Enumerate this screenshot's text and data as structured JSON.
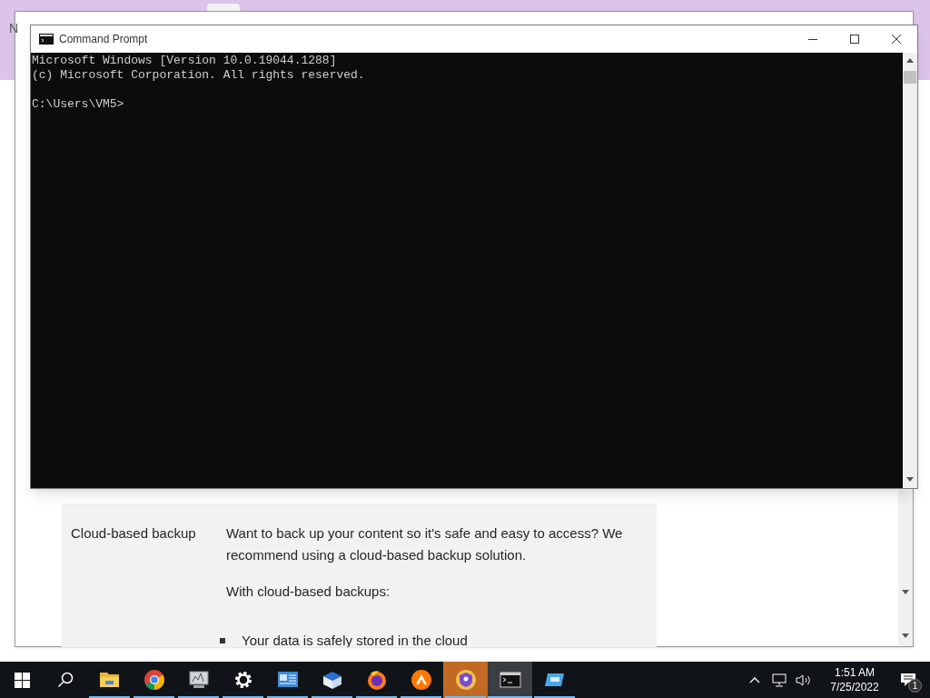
{
  "back_window": {
    "title": "N"
  },
  "article": {
    "label": "Cloud-based backup",
    "paragraphs": [
      "Want to back up your content so it's safe and easy to access? We recommend using a cloud-based backup solution.",
      "With cloud-based backups:"
    ],
    "bullets": [
      "Your data is safely stored in the cloud"
    ]
  },
  "console_window": {
    "title": "Command Prompt",
    "banner": [
      "Microsoft Windows [Version 10.0.19044.1288]",
      "(c) Microsoft Corporation. All rights reserved."
    ],
    "prompt": "C:\\Users\\VM5>"
  },
  "taskbar": {
    "apps": [
      {
        "kind": "folder",
        "selected": false,
        "highlighted": false,
        "running": true
      },
      {
        "kind": "chrome",
        "selected": false,
        "highlighted": false,
        "running": true
      },
      {
        "kind": "monitor",
        "selected": false,
        "highlighted": false,
        "running": true
      },
      {
        "kind": "gear",
        "selected": false,
        "highlighted": false,
        "running": true
      },
      {
        "kind": "panel",
        "selected": false,
        "highlighted": false,
        "running": true
      },
      {
        "kind": "box",
        "selected": false,
        "highlighted": false,
        "running": true
      },
      {
        "kind": "firefox",
        "selected": false,
        "highlighted": false,
        "running": true
      },
      {
        "kind": "avast",
        "selected": false,
        "highlighted": false,
        "running": true
      },
      {
        "kind": "shield",
        "selected": false,
        "highlighted": true,
        "running": true
      },
      {
        "kind": "console",
        "selected": true,
        "highlighted": false,
        "running": true
      },
      {
        "kind": "remote",
        "selected": false,
        "highlighted": false,
        "running": true
      }
    ],
    "time": "1:51 AM",
    "date": "7/25/2022",
    "notifications": "1"
  }
}
